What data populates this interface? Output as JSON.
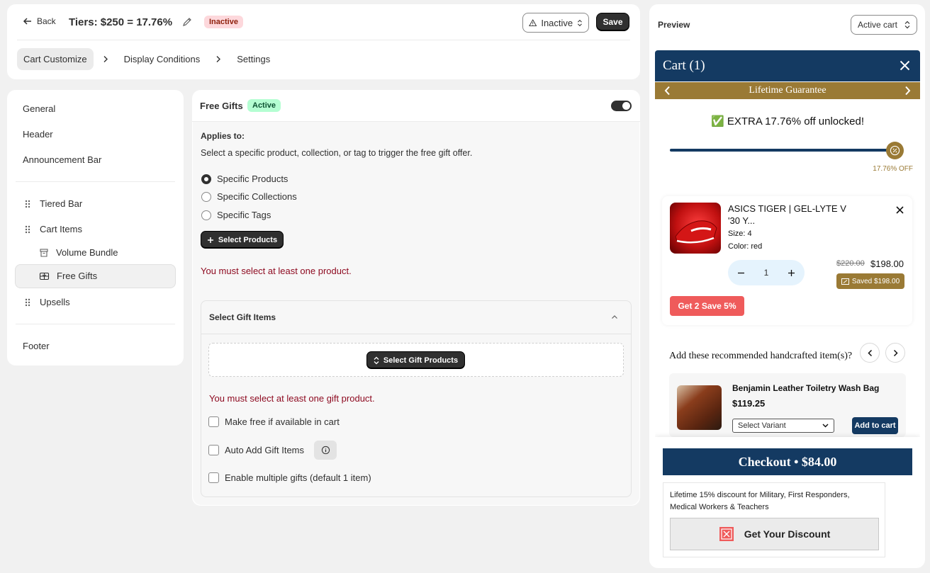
{
  "topbar": {
    "back_label": "Back",
    "title": "Tiers: $250 = 17.76%",
    "status_badge": "Inactive",
    "status_select": "Inactive",
    "save_label": "Save",
    "steps": [
      "Cart Customize",
      "Display Conditions",
      "Settings"
    ]
  },
  "nav": {
    "general": "General",
    "header": "Header",
    "announcement": "Announcement Bar",
    "tiered_bar": "Tiered Bar",
    "cart_items": "Cart Items",
    "volume_bundle": "Volume Bundle",
    "free_gifts": "Free Gifts",
    "upsells": "Upsells",
    "footer": "Footer"
  },
  "form": {
    "title": "Free Gifts",
    "status": "Active",
    "toggle_on": true,
    "applies_label": "Applies to:",
    "applies_help": "Select a specific product, collection, or tag to trigger the free gift offer.",
    "options": [
      "Specific Products",
      "Specific Collections",
      "Specific Tags"
    ],
    "selected_option": "Specific Products",
    "select_products_label": "Select Products",
    "error_products": "You must select at least one product.",
    "gift_section_title": "Select Gift Items",
    "select_gift_label": "Select Gift Products",
    "error_gifts": "You must select at least one gift product.",
    "checks": [
      "Make free if available in cart",
      "Auto Add Gift Items",
      "Enable multiple gifts (default 1 item)"
    ]
  },
  "preview": {
    "title": "Preview",
    "select": "Active cart",
    "cart_title": "Cart (1)",
    "announcement": "Lifetime Guarantee",
    "unlock_emoji": "✅",
    "unlock_text": "EXTRA 17.76% off unlocked!",
    "progress": 1.0,
    "progress_label": "17.76% OFF",
    "item": {
      "name": "ASICS TIGER | GEL-LYTE V '30 Y...",
      "size": "Size: 4",
      "color": "Color: red",
      "qty": "1",
      "price_old": "$220.00",
      "price_new": "$198.00",
      "saved": "Saved $198.00",
      "deal": "Get 2 Save 5%"
    },
    "rec_title": "Add these recommended handcrafted item(s)?",
    "rec": {
      "name": "Benjamin Leather Toiletry Wash Bag",
      "price": "$119.25",
      "variant": "Select Variant",
      "add_label": "Add to cart"
    },
    "checkout": "Checkout • $84.00",
    "promo_text": "Lifetime 15% discount for Military, First Responders, Medical Workers & Teachers",
    "discount_btn": "Get Your Discount"
  },
  "colors": {
    "brand_navy": "#143a62",
    "gold": "#9a7a35",
    "error": "#8e0b21",
    "active_badge": "#b4fed2",
    "inactive_badge": "#fdd8dc"
  }
}
